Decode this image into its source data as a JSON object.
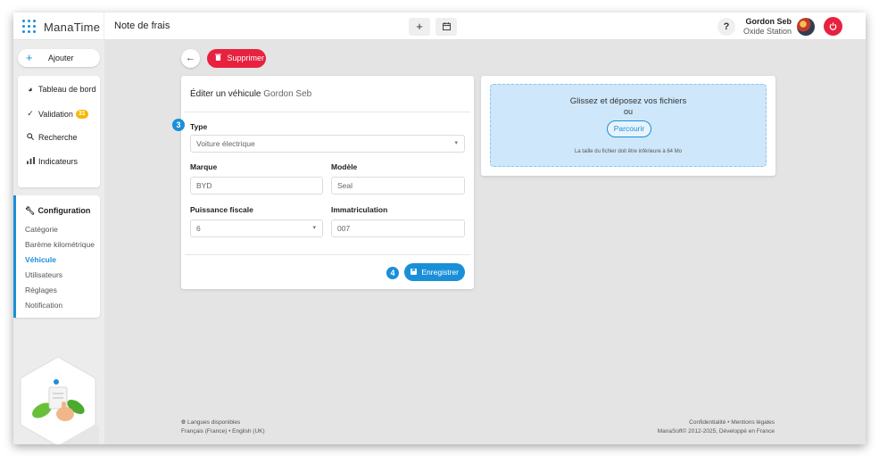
{
  "app": {
    "name": "ManaTime",
    "page_title": "Note de frais"
  },
  "header": {
    "add_label": "+",
    "calendar_icon": "calendar-icon",
    "help_label": "?",
    "user_name": "Gordon Seb",
    "user_org": "Oxide Station"
  },
  "sidebar": {
    "add_label": "Ajouter",
    "items": [
      {
        "label": "Tableau de bord",
        "icon": "pie-chart-icon"
      },
      {
        "label": "Validation",
        "icon": "check-icon",
        "badge": "31"
      },
      {
        "label": "Recherche",
        "icon": "search-icon"
      },
      {
        "label": "Indicateurs",
        "icon": "bar-chart-icon"
      }
    ],
    "config": {
      "title": "Configuration",
      "icon": "wrench-icon",
      "items": [
        "Catégorie",
        "Barème kilométrique",
        "Véhicule",
        "Utilisateurs",
        "Réglages",
        "Notification"
      ],
      "active": "Véhicule"
    }
  },
  "toolbar": {
    "delete_label": "Supprimer"
  },
  "form": {
    "title": "Éditer un véhicule",
    "title_owner": "Gordon Seb",
    "step_type": "3",
    "step_save": "4",
    "type": {
      "label": "Type",
      "value": "Voiture électrique"
    },
    "marque": {
      "label": "Marque",
      "value": "BYD"
    },
    "modele": {
      "label": "Modèle",
      "value": "Seal"
    },
    "puissance": {
      "label": "Puissance fiscale",
      "value": "6"
    },
    "immat": {
      "label": "Immatriculation",
      "value": "007"
    },
    "save_label": "Enregistrer"
  },
  "upload": {
    "main": "Glissez et déposez vos fichiers",
    "or": "ou",
    "browse": "Parcourir",
    "note": "La taille du fichier doit être inférieure à 64 Mo"
  },
  "footer": {
    "lang_title": "Langues disponibles",
    "langs": "Français (France) • English (UK)",
    "links": "Confidentialité • Mentions légales",
    "copyright": "ManaSoft© 2012-2025, Développé en France"
  },
  "colors": {
    "accent": "#1a8fd9",
    "danger": "#e8213f",
    "badge": "#f5b800"
  }
}
